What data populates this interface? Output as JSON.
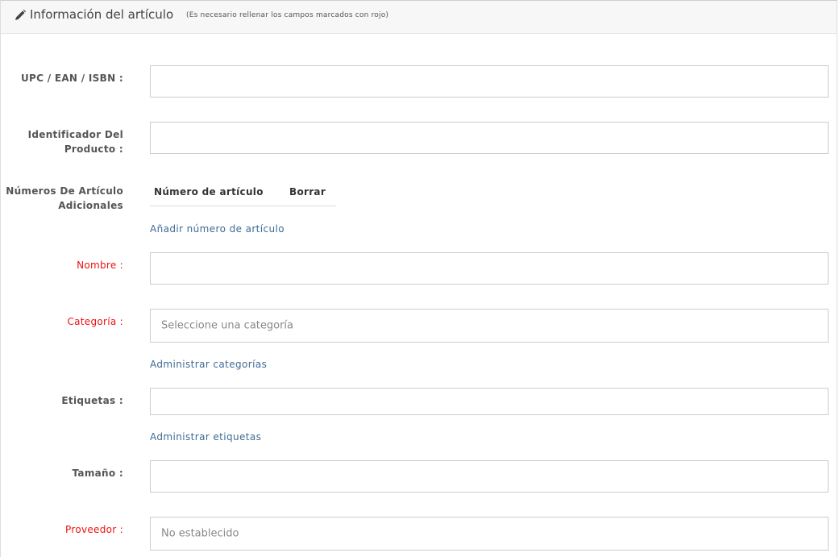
{
  "panel": {
    "icon": "pencil-icon",
    "title": "Información del artículo",
    "note": "(Es necesario rellenar los campos marcados con rojo)"
  },
  "fields": {
    "upc": {
      "label": "UPC / EAN / ISBN :",
      "value": ""
    },
    "product_id": {
      "label_line1": "Identificador Del",
      "label_line2": "Producto :",
      "value": ""
    },
    "additional": {
      "label_line1": "Números De Artículo",
      "label_line2": "Adicionales",
      "col_number": "Número de artículo",
      "col_delete": "Borrar",
      "add_link": "Añadir número de artículo"
    },
    "name": {
      "label": "Nombre :",
      "value": "",
      "required": true
    },
    "category": {
      "label": "Categoría :",
      "placeholder": "Seleccione una categoría",
      "manage_link": "Administrar categorías",
      "required": true
    },
    "tags": {
      "label": "Etiquetas :",
      "value": "",
      "manage_link": "Administrar etiquetas"
    },
    "size": {
      "label": "Tamaño :",
      "value": ""
    },
    "supplier": {
      "label": "Proveedor :",
      "selected": "No establecido",
      "required": true
    }
  },
  "colors": {
    "required_label": "#ee1111",
    "link": "#3f6b94"
  }
}
